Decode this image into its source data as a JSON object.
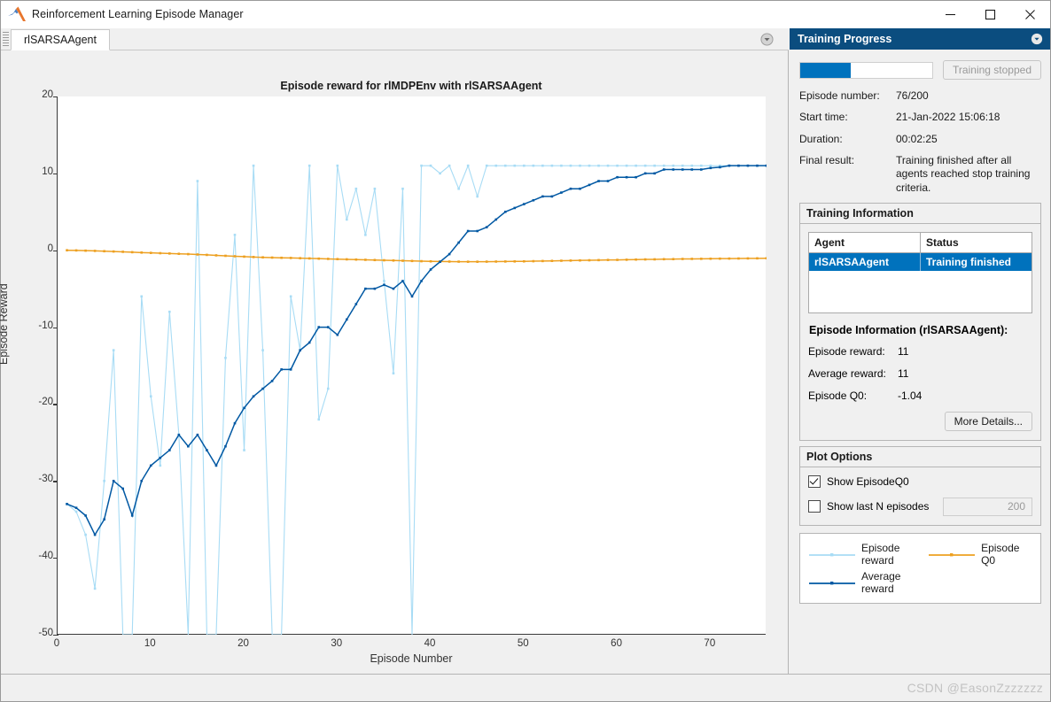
{
  "window": {
    "title": "Reinforcement Learning Episode Manager",
    "logo_icon": "matlab-logo-icon",
    "controls": [
      {
        "name": "minimize-button",
        "icon": "minimize-icon"
      },
      {
        "name": "maximize-button",
        "icon": "maximize-icon"
      },
      {
        "name": "close-button",
        "icon": "close-icon"
      }
    ]
  },
  "tabbar": {
    "tabs": [
      {
        "label": "rlSARSAAgent"
      }
    ],
    "dropdown_icon": "chevron-down-circle-icon"
  },
  "chart_data": {
    "type": "line",
    "title": "Episode reward for rlMDPEnv with rlSARSAAgent",
    "xlabel": "Episode Number",
    "ylabel": "Episode Reward",
    "xlim": [
      0,
      76
    ],
    "ylim": [
      -50,
      20
    ],
    "xticks": [
      0,
      10,
      20,
      30,
      40,
      50,
      60,
      70
    ],
    "yticks": [
      -50,
      -40,
      -30,
      -20,
      -10,
      0,
      10,
      20
    ],
    "grid": false,
    "legend_position": "external-bottom-right",
    "x": [
      1,
      2,
      3,
      4,
      5,
      6,
      7,
      8,
      9,
      10,
      11,
      12,
      13,
      14,
      15,
      16,
      17,
      18,
      19,
      20,
      21,
      22,
      23,
      24,
      25,
      26,
      27,
      28,
      29,
      30,
      31,
      32,
      33,
      34,
      35,
      36,
      37,
      38,
      39,
      40,
      41,
      42,
      43,
      44,
      45,
      46,
      47,
      48,
      49,
      50,
      51,
      52,
      53,
      54,
      55,
      56,
      57,
      58,
      59,
      60,
      61,
      62,
      63,
      64,
      65,
      66,
      67,
      68,
      69,
      70,
      71,
      72,
      73,
      74,
      75,
      76
    ],
    "series": [
      {
        "name": "Episode reward",
        "color": "#a8dcf5",
        "values": [
          -33,
          -34,
          -37,
          -44,
          -30,
          -13,
          -60,
          -50,
          -6,
          -19,
          -28,
          -8,
          -24,
          -50,
          9,
          -50,
          -50,
          -14,
          2,
          -26,
          11,
          -13,
          -50,
          -50,
          -6,
          -13,
          11,
          -22,
          -18,
          11,
          4,
          8,
          2,
          8,
          -4,
          -16,
          8,
          -50,
          11,
          11,
          10,
          11,
          8,
          11,
          7,
          11,
          11,
          11,
          11,
          11,
          11,
          11,
          11,
          11,
          11,
          11,
          11,
          11,
          11,
          11,
          11,
          11,
          11,
          11,
          11,
          11,
          11,
          11,
          11,
          11,
          11,
          11,
          11,
          11,
          11,
          11
        ]
      },
      {
        "name": "Average reward",
        "color": "#0058a3",
        "values": [
          -33,
          -33.5,
          -34.5,
          -37,
          -35,
          -30,
          -31,
          -34.5,
          -30,
          -28,
          -27,
          -26,
          -24,
          -25.5,
          -24,
          -26,
          -28,
          -25.5,
          -22.5,
          -20.5,
          -19,
          -18,
          -17,
          -15.5,
          -15.5,
          -13,
          -12,
          -10,
          -10,
          -11,
          -9,
          -7,
          -5,
          -5,
          -4.5,
          -5,
          -4,
          -6,
          -4,
          -2.5,
          -1.5,
          -0.5,
          1,
          2.5,
          2.5,
          3,
          4,
          5,
          5.5,
          6,
          6.5,
          7,
          7,
          7.5,
          8,
          8,
          8.5,
          9,
          9,
          9.5,
          9.5,
          9.5,
          10,
          10,
          10.5,
          10.5,
          10.5,
          10.5,
          10.5,
          10.7,
          10.8,
          11,
          11,
          11,
          11,
          11
        ]
      },
      {
        "name": "Episode Q0",
        "color": "#eda021",
        "values": [
          0,
          -0.02,
          -0.05,
          -0.08,
          -0.12,
          -0.16,
          -0.2,
          -0.25,
          -0.3,
          -0.34,
          -0.38,
          -0.42,
          -0.46,
          -0.5,
          -0.55,
          -0.6,
          -0.66,
          -0.72,
          -0.78,
          -0.83,
          -0.88,
          -0.92,
          -0.95,
          -0.98,
          -1.0,
          -1.03,
          -1.06,
          -1.09,
          -1.12,
          -1.15,
          -1.18,
          -1.21,
          -1.24,
          -1.27,
          -1.3,
          -1.33,
          -1.36,
          -1.39,
          -1.42,
          -1.44,
          -1.46,
          -1.47,
          -1.48,
          -1.49,
          -1.49,
          -1.48,
          -1.47,
          -1.46,
          -1.45,
          -1.44,
          -1.42,
          -1.4,
          -1.38,
          -1.36,
          -1.34,
          -1.32,
          -1.3,
          -1.28,
          -1.26,
          -1.25,
          -1.23,
          -1.21,
          -1.19,
          -1.18,
          -1.16,
          -1.15,
          -1.13,
          -1.12,
          -1.11,
          -1.1,
          -1.09,
          -1.08,
          -1.07,
          -1.06,
          -1.05,
          -1.04
        ]
      }
    ]
  },
  "side_panel": {
    "header": {
      "title": "Training Progress",
      "dropdown_icon": "chevron-down-circle-icon"
    },
    "progress": {
      "percent": 38,
      "fill_color": "#0072bd",
      "button_label": "Training stopped"
    },
    "info": [
      {
        "key": "Episode number:",
        "value": "76/200"
      },
      {
        "key": "Start time:",
        "value": "21-Jan-2022 15:06:18"
      },
      {
        "key": "Duration:",
        "value": "00:02:25"
      },
      {
        "key": "Final result:",
        "value": "Training finished after all agents reached stop training criteria."
      }
    ],
    "training_information": {
      "title": "Training Information",
      "columns": [
        "Agent",
        "Status"
      ],
      "rows": [
        {
          "agent": "rlSARSAAgent",
          "status": "Training finished"
        }
      ],
      "selected_color": "#0072bd"
    },
    "episode_information": {
      "title": "Episode Information (rlSARSAAgent):",
      "items": [
        {
          "key": "Episode reward:",
          "value": "11"
        },
        {
          "key": "Average reward:",
          "value": "11"
        },
        {
          "key": "Episode Q0:",
          "value": "-1.04"
        }
      ],
      "more_details_label": "More Details..."
    },
    "plot_options": {
      "title": "Plot Options",
      "show_episode_q0": {
        "label": "Show EpisodeQ0",
        "checked": true
      },
      "show_last_n": {
        "label": "Show last N episodes",
        "checked": false,
        "value": "200"
      }
    },
    "legend": [
      {
        "label": "Episode reward",
        "color": "#a8dcf5"
      },
      {
        "label": "Episode Q0",
        "color": "#eda021"
      },
      {
        "label": "Average reward",
        "color": "#0058a3"
      }
    ]
  },
  "statusbar": {
    "watermark": "CSDN @EasonZzzzzzz"
  }
}
